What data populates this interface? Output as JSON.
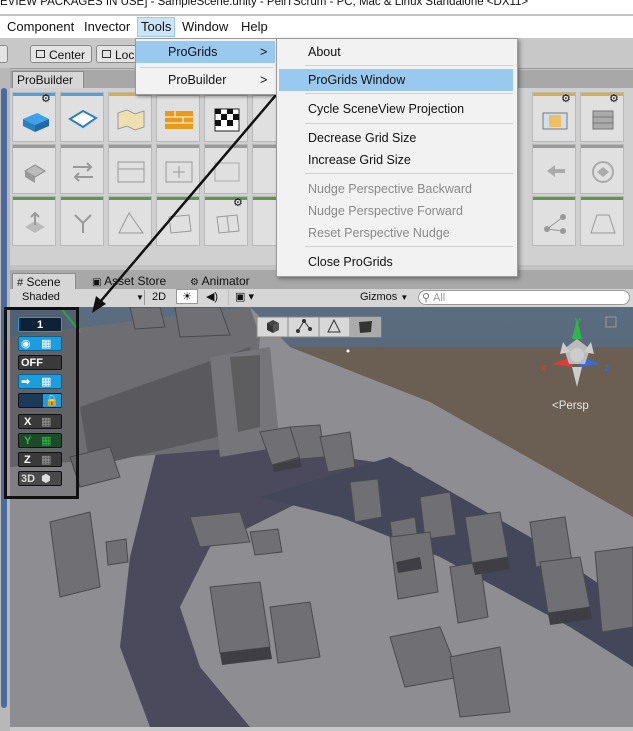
{
  "window": {
    "title": "EVIEW PACKAGES IN USE] - SampleScene.unity - PeliTScrum - PC, Mac & Linux Standalone <DX11>"
  },
  "menubar": {
    "items": [
      {
        "label": "Component"
      },
      {
        "label": "Invector"
      },
      {
        "label": "Tools"
      },
      {
        "label": "Window"
      },
      {
        "label": "Help"
      }
    ]
  },
  "toolbar": {
    "center_label": "Center",
    "local_label": "Loc"
  },
  "probuilder": {
    "tab_label": "ProBuilder"
  },
  "tools_menu": {
    "items": [
      {
        "label": "ProGrids",
        "arrow": ">"
      },
      {
        "label": "ProBuilder",
        "arrow": ">"
      }
    ]
  },
  "progrids_submenu": {
    "items": [
      {
        "label": "About",
        "enabled": true
      },
      {
        "label": "ProGrids Window",
        "enabled": true,
        "highlighted": true
      },
      {
        "label": "Cycle SceneView Projection",
        "enabled": true
      },
      {
        "label": "Decrease Grid Size",
        "enabled": true
      },
      {
        "label": "Increase Grid Size",
        "enabled": true
      },
      {
        "label": "Nudge Perspective Backward",
        "enabled": false
      },
      {
        "label": "Nudge Perspective Forward",
        "enabled": false
      },
      {
        "label": "Reset Perspective Nudge",
        "enabled": false
      },
      {
        "label": "Close ProGrids",
        "enabled": true
      }
    ]
  },
  "scene_tabs": [
    {
      "label": "Scene"
    },
    {
      "label": "Asset Store"
    },
    {
      "label": "Animator"
    }
  ],
  "scene_toolbar": {
    "shading_mode": "Shaded",
    "mode_2d": "2D",
    "gizmos_label": "Gizmos",
    "search_placeholder": "All"
  },
  "progrids_panel": {
    "grid_size": "1",
    "off_label": "OFF",
    "x_label": "X",
    "y_label": "Y",
    "z_label": "Z",
    "label_3d": "3D"
  },
  "gizmo": {
    "x_label": "x",
    "y_label": "y",
    "z_label": "z",
    "projection_label": "Persp"
  },
  "colors": {
    "menu_highlight": "#99c9ef",
    "progrids_blue": "#1b9ee0",
    "progrids_green": "#2fb84a",
    "accent_red": "#e03a3a"
  }
}
